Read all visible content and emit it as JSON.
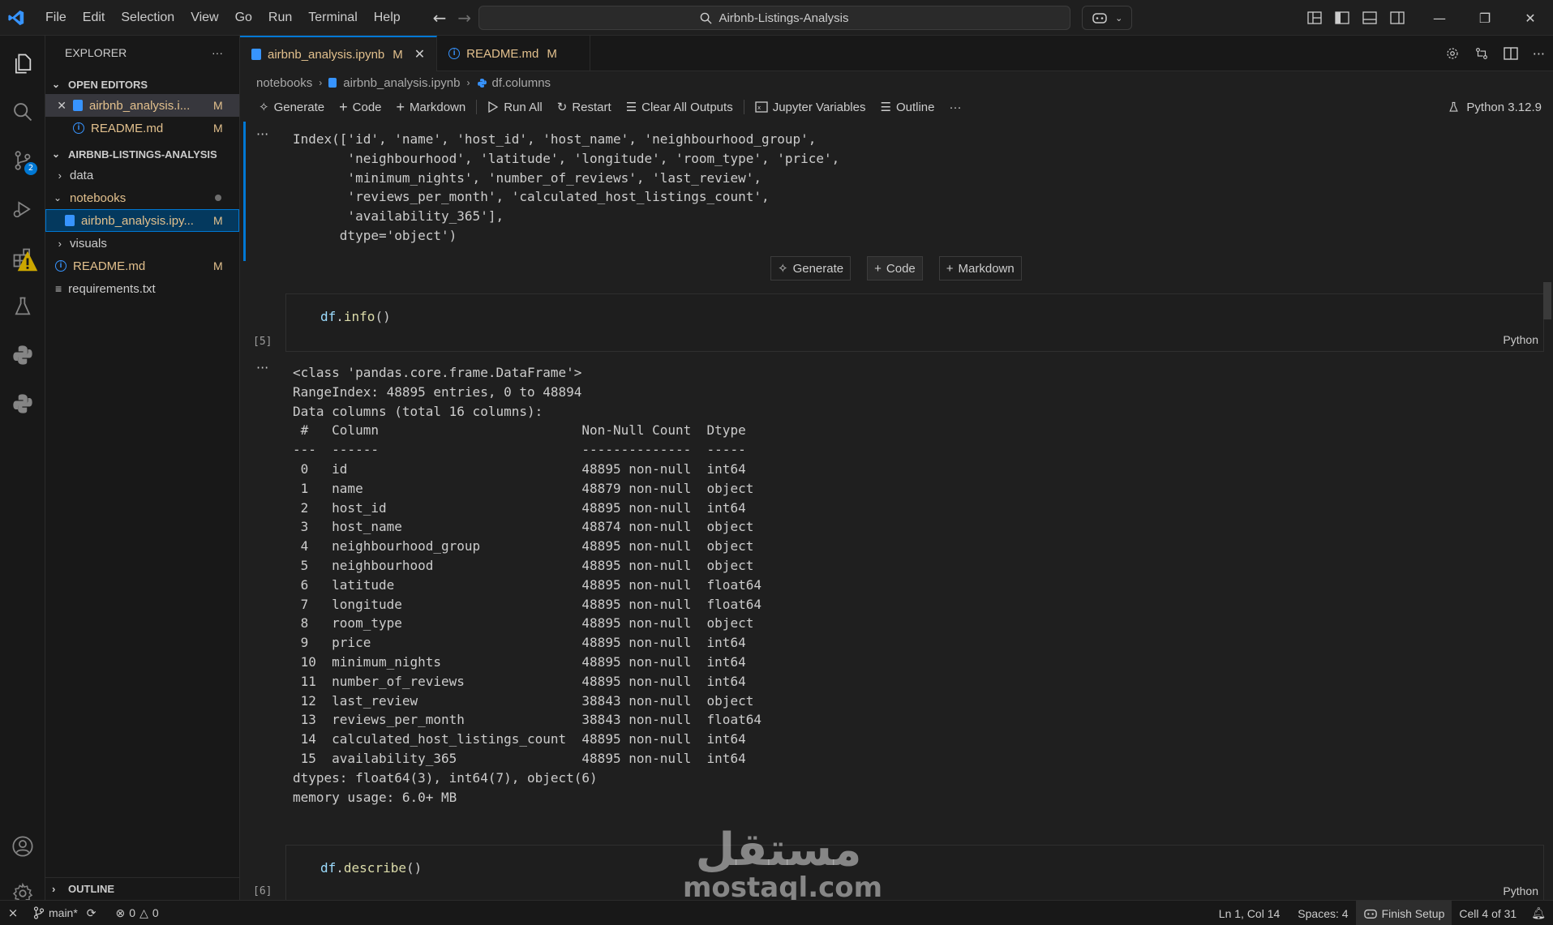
{
  "menu": [
    "File",
    "Edit",
    "Selection",
    "View",
    "Go",
    "Run",
    "Terminal",
    "Help"
  ],
  "search": {
    "text": "Airbnb-Listings-Analysis"
  },
  "sidebar": {
    "title": "EXPLORER",
    "more": "···",
    "open_editors": {
      "label": "OPEN EDITORS",
      "items": [
        {
          "name": "airbnb_analysis.i...",
          "status": "M"
        },
        {
          "name": "README.md",
          "status": "M"
        }
      ]
    },
    "project": {
      "label": "AIRBNB-LISTINGS-ANALYSIS",
      "items": [
        {
          "name": "data"
        },
        {
          "name": "notebooks"
        },
        {
          "name": "airbnb_analysis.ipy...",
          "status": "M"
        },
        {
          "name": "visuals"
        },
        {
          "name": "README.md",
          "status": "M"
        },
        {
          "name": "requirements.txt"
        }
      ]
    },
    "outline": "OUTLINE"
  },
  "activity": {
    "scm_badge": "2"
  },
  "tabs": [
    {
      "label": "airbnb_analysis.ipynb",
      "status": "M",
      "close": "✕"
    },
    {
      "label": "README.md",
      "status": "M"
    }
  ],
  "breadcrumb": {
    "folder": "notebooks",
    "file": "airbnb_analysis.ipynb",
    "symbol": "df.columns"
  },
  "toolbar": {
    "generate": "Generate",
    "code": "Code",
    "markdown": "Markdown",
    "run_all": "Run All",
    "restart": "Restart",
    "clear": "Clear All Outputs",
    "variables": "Jupyter Variables",
    "outline": "Outline",
    "more": "···",
    "kernel": "Python 3.12.9"
  },
  "cells": {
    "out_dots": "···",
    "columns_output": "Index(['id', 'name', 'host_id', 'host_name', 'neighbourhood_group',\n       'neighbourhood', 'latitude', 'longitude', 'room_type', 'price',\n       'minimum_nights', 'number_of_reviews', 'last_review',\n       'reviews_per_month', 'calculated_host_listings_count',\n       'availability_365'],\n      dtype='object')",
    "insert": {
      "generate": "Generate",
      "code": "Code",
      "markdown": "Markdown"
    },
    "info": {
      "fn": "info",
      "count": "[5]",
      "lang": "Python"
    },
    "info_output": "<class 'pandas.core.frame.DataFrame'>\nRangeIndex: 48895 entries, 0 to 48894\nData columns (total 16 columns):\n #   Column                          Non-Null Count  Dtype  \n---  ------                          --------------  -----  \n 0   id                              48895 non-null  int64  \n 1   name                            48879 non-null  object \n 2   host_id                         48895 non-null  int64  \n 3   host_name                       48874 non-null  object \n 4   neighbourhood_group             48895 non-null  object \n 5   neighbourhood                   48895 non-null  object \n 6   latitude                        48895 non-null  float64\n 7   longitude                       48895 non-null  float64\n 8   room_type                       48895 non-null  object \n 9   price                           48895 non-null  int64  \n 10  minimum_nights                  48895 non-null  int64  \n 11  number_of_reviews               48895 non-null  int64  \n 12  last_review                     38843 non-null  object \n 13  reviews_per_month               38843 non-null  float64\n 14  calculated_host_listings_count  48895 non-null  int64  \n 15  availability_365                48895 non-null  int64  \ndtypes: float64(3), int64(7), object(6)\nmemory usage: 6.0+ MB",
    "describe": {
      "fn": "describe",
      "count": "[6]",
      "lang": "Python"
    },
    "var": "df",
    "call_dot": ".",
    "parens": "()"
  },
  "watermark": {
    "arabic": "مستقل",
    "latin": "mostaql.com"
  },
  "status": {
    "branch": "main*",
    "errors": "0",
    "warnings": "0",
    "position": "Ln 1, Col 14",
    "spaces": "Spaces: 4",
    "finish_setup": "Finish Setup",
    "cell": "Cell 4 of 31"
  },
  "colors": {
    "accent": "#0078d4",
    "modified": "#e2c08d",
    "background": "#1f1f1f"
  }
}
